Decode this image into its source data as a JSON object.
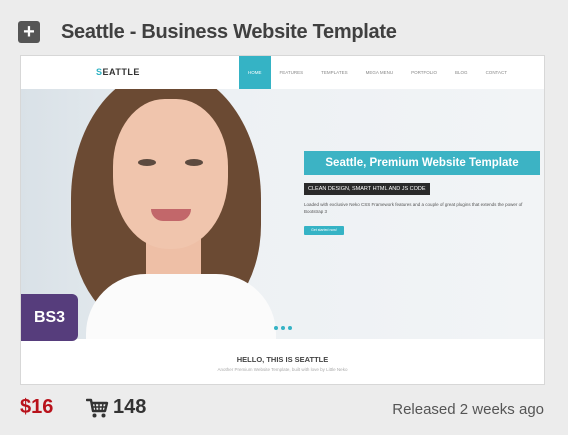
{
  "header": {
    "title": "Seattle - Business Website Template",
    "expand_symbol": "+"
  },
  "preview": {
    "logo_prefix": "S",
    "logo_rest": "EATTLE",
    "nav": [
      "HOME",
      "FEATURES",
      "TEMPLATES",
      "MEGA MENU",
      "PORTFOLIO",
      "BLOG",
      "CONTACT"
    ],
    "hero_title": "Seattle, Premium Website Template",
    "hero_tag": "CLEAN DESIGN, SMART HTML AND JS CODE",
    "hero_desc": "Loaded with exclusive Neko CSS Framework features and a couple of great plugins that extends the power of Bootstrap 3",
    "hero_button": "Get started now!",
    "section_title": "HELLO, THIS IS SEATTLE",
    "section_sub": "Another Premium Website Template, built with love by Little Neko"
  },
  "badge": "BS3",
  "footer": {
    "price": "$16",
    "sales": "148",
    "released": "Released 2 weeks ago"
  },
  "icons": {
    "expand": "plus-square-icon",
    "cart": "shopping-cart-icon"
  },
  "colors": {
    "accent": "#35b3c5",
    "price": "#b8121b",
    "badge": "#563d7c"
  }
}
